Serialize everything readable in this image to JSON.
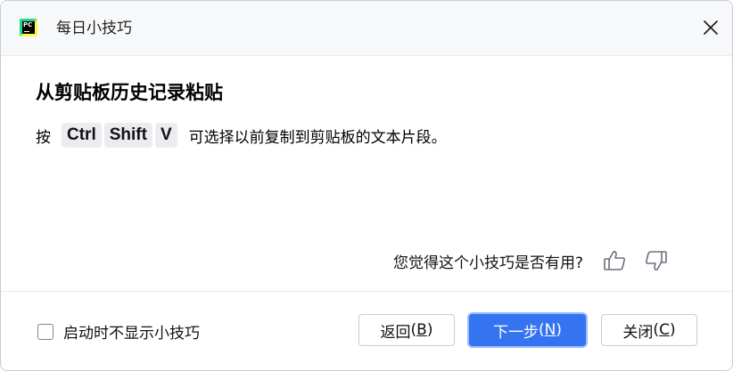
{
  "dialog": {
    "title": "每日小技巧",
    "app_icon": "pycharm-icon",
    "close_icon": "close-icon"
  },
  "tip": {
    "heading": "从剪贴板历史记录粘贴",
    "press_text": "按",
    "keys": [
      "Ctrl",
      "Shift",
      "V"
    ],
    "rest_text": "可选择以前复制到剪贴板的文本片段。"
  },
  "feedback": {
    "question": "您觉得这个小技巧是否有用?",
    "thumbs_up_icon": "thumbs-up-icon",
    "thumbs_down_icon": "thumbs-down-icon"
  },
  "footer": {
    "checkbox_label": "启动时不显示小技巧",
    "checkbox_checked": false,
    "back_label": "返回",
    "back_mnemonic": "B",
    "next_label": "下一步",
    "next_mnemonic": "N",
    "close_label": "关闭",
    "close_mnemonic": "C"
  },
  "colors": {
    "accent": "#3574f0",
    "titlebar_bg": "#f7f8fa",
    "key_bg": "#ebecf0"
  }
}
